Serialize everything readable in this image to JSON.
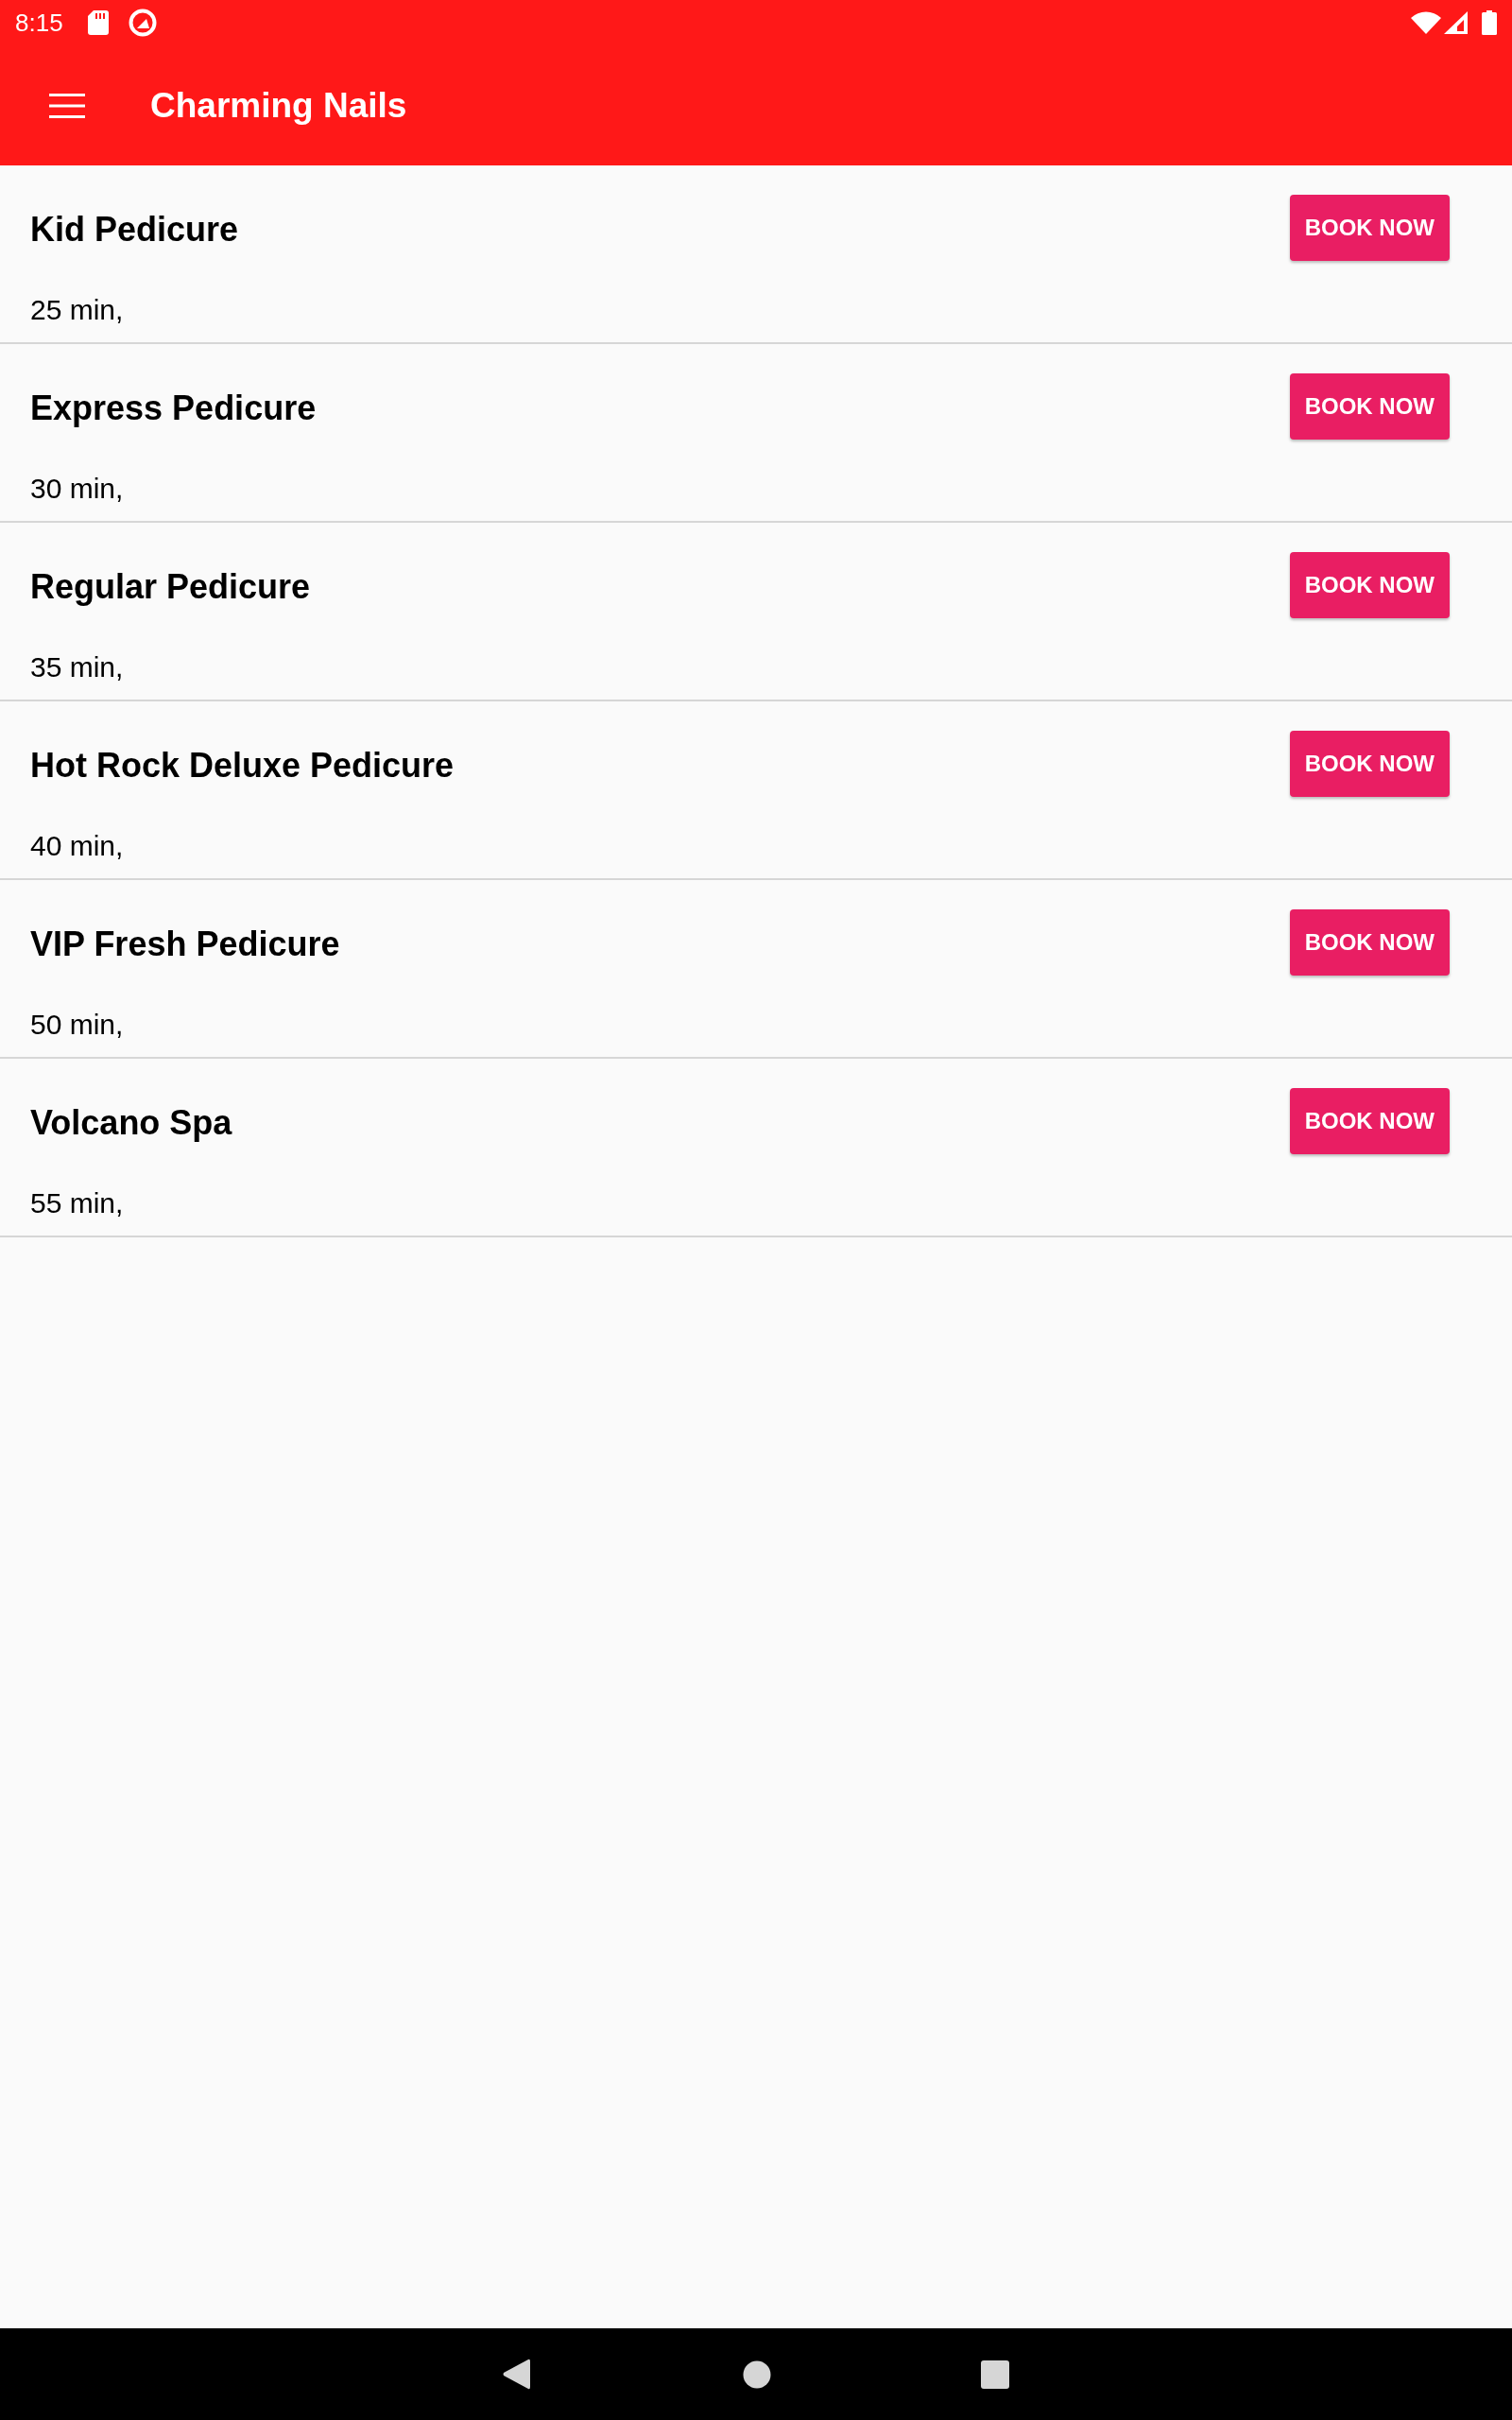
{
  "status_bar": {
    "time": "8:15"
  },
  "app_bar": {
    "title": "Charming Nails"
  },
  "services": [
    {
      "name": "Kid Pedicure",
      "duration": "25 min,",
      "button": "BOOK NOW"
    },
    {
      "name": "Express Pedicure",
      "duration": "30 min,",
      "button": "BOOK NOW"
    },
    {
      "name": "Regular Pedicure",
      "duration": "35 min,",
      "button": "BOOK NOW"
    },
    {
      "name": "Hot Rock Deluxe Pedicure",
      "duration": "40 min,",
      "button": "BOOK NOW"
    },
    {
      "name": "VIP Fresh Pedicure",
      "duration": "50 min,",
      "button": "BOOK NOW"
    },
    {
      "name": "Volcano Spa",
      "duration": "55 min,",
      "button": "BOOK NOW"
    }
  ]
}
